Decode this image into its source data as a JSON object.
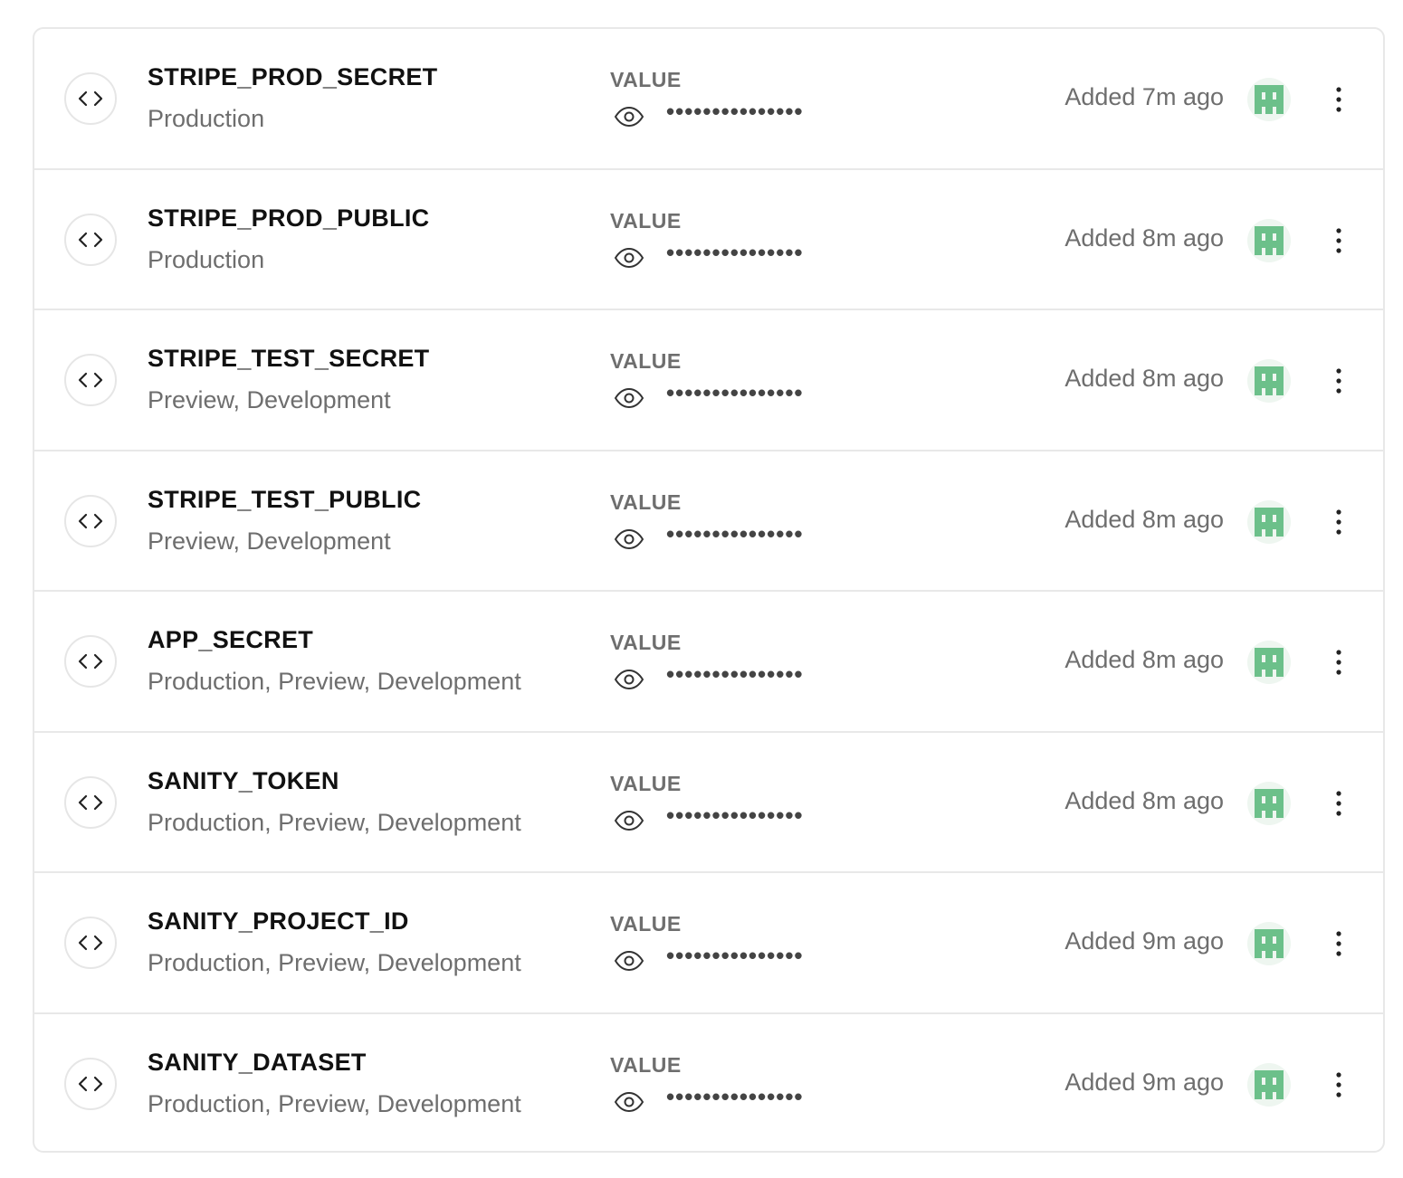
{
  "env_vars": {
    "value_label": "VALUE",
    "masked_value": "•••••••••••••••",
    "avatar_color": "#6cc08a",
    "rows": [
      {
        "name": "STRIPE_PROD_SECRET",
        "environments": "Production",
        "added": "Added 7m ago"
      },
      {
        "name": "STRIPE_PROD_PUBLIC",
        "environments": "Production",
        "added": "Added 8m ago"
      },
      {
        "name": "STRIPE_TEST_SECRET",
        "environments": "Preview, Development",
        "added": "Added 8m ago"
      },
      {
        "name": "STRIPE_TEST_PUBLIC",
        "environments": "Preview, Development",
        "added": "Added 8m ago"
      },
      {
        "name": "APP_SECRET",
        "environments": "Production, Preview, Development",
        "added": "Added 8m ago"
      },
      {
        "name": "SANITY_TOKEN",
        "environments": "Production, Preview, Development",
        "added": "Added 8m ago"
      },
      {
        "name": "SANITY_PROJECT_ID",
        "environments": "Production, Preview, Development",
        "added": "Added 9m ago"
      },
      {
        "name": "SANITY_DATASET",
        "environments": "Production, Preview, Development",
        "added": "Added 9m ago"
      }
    ]
  }
}
